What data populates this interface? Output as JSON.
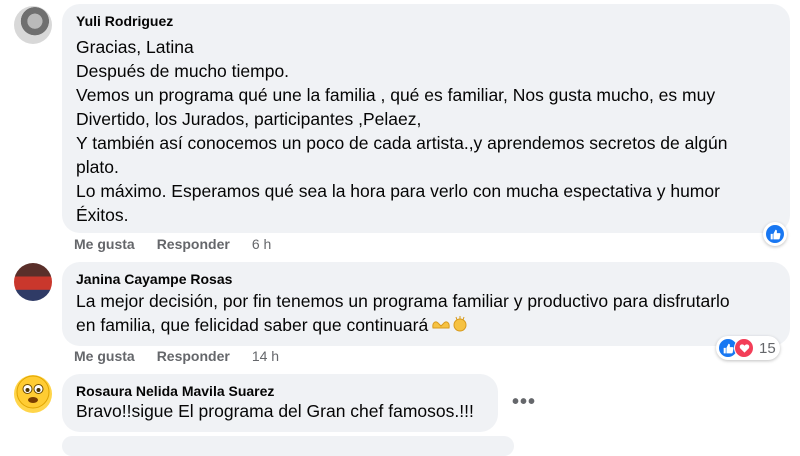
{
  "comments": [
    {
      "author": "Yuli Rodriguez",
      "lines": [
        "Gracias, Latina",
        "Después de mucho tiempo.",
        "Vemos un programa qué une la familia , qué es familiar, Nos gusta mucho, es muy",
        "Divertido, los Jurados, participantes ,Pelaez,",
        "Y también así conocemos un poco de cada artista.,y aprendemos secretos de algún",
        "plato.",
        "Lo máximo. Esperamos qué sea la hora para verlo con mucha espectativa y humor",
        "Éxitos."
      ],
      "like_label": "Me gusta",
      "reply_label": "Responder",
      "time": "6 h"
    },
    {
      "author": "Janina Cayampe Rosas",
      "lines": [
        "La mejor decisión, por fin tenemos un programa familiar y productivo para disfrutarlo",
        "en familia, que felicidad saber que continuará"
      ],
      "like_label": "Me gusta",
      "reply_label": "Responder",
      "time": "14 h",
      "reaction_count": "15"
    },
    {
      "author": "Rosaura Nelida Mavila Suarez",
      "lines": [
        "Bravo!!sigue El programa del Gran chef famosos.!!!"
      ]
    }
  ],
  "more_options": "•••",
  "colors": {
    "bubble": "#f0f2f5",
    "like_blue": "#1877f2",
    "love_red": "#f33e58",
    "meta_gray": "#65676b"
  },
  "icons": [
    "like-reaction-icon",
    "love-reaction-icon",
    "heart-hands-emoji-icon",
    "clapping-hands-emoji-icon",
    "worried-face-emoji-icon"
  ]
}
